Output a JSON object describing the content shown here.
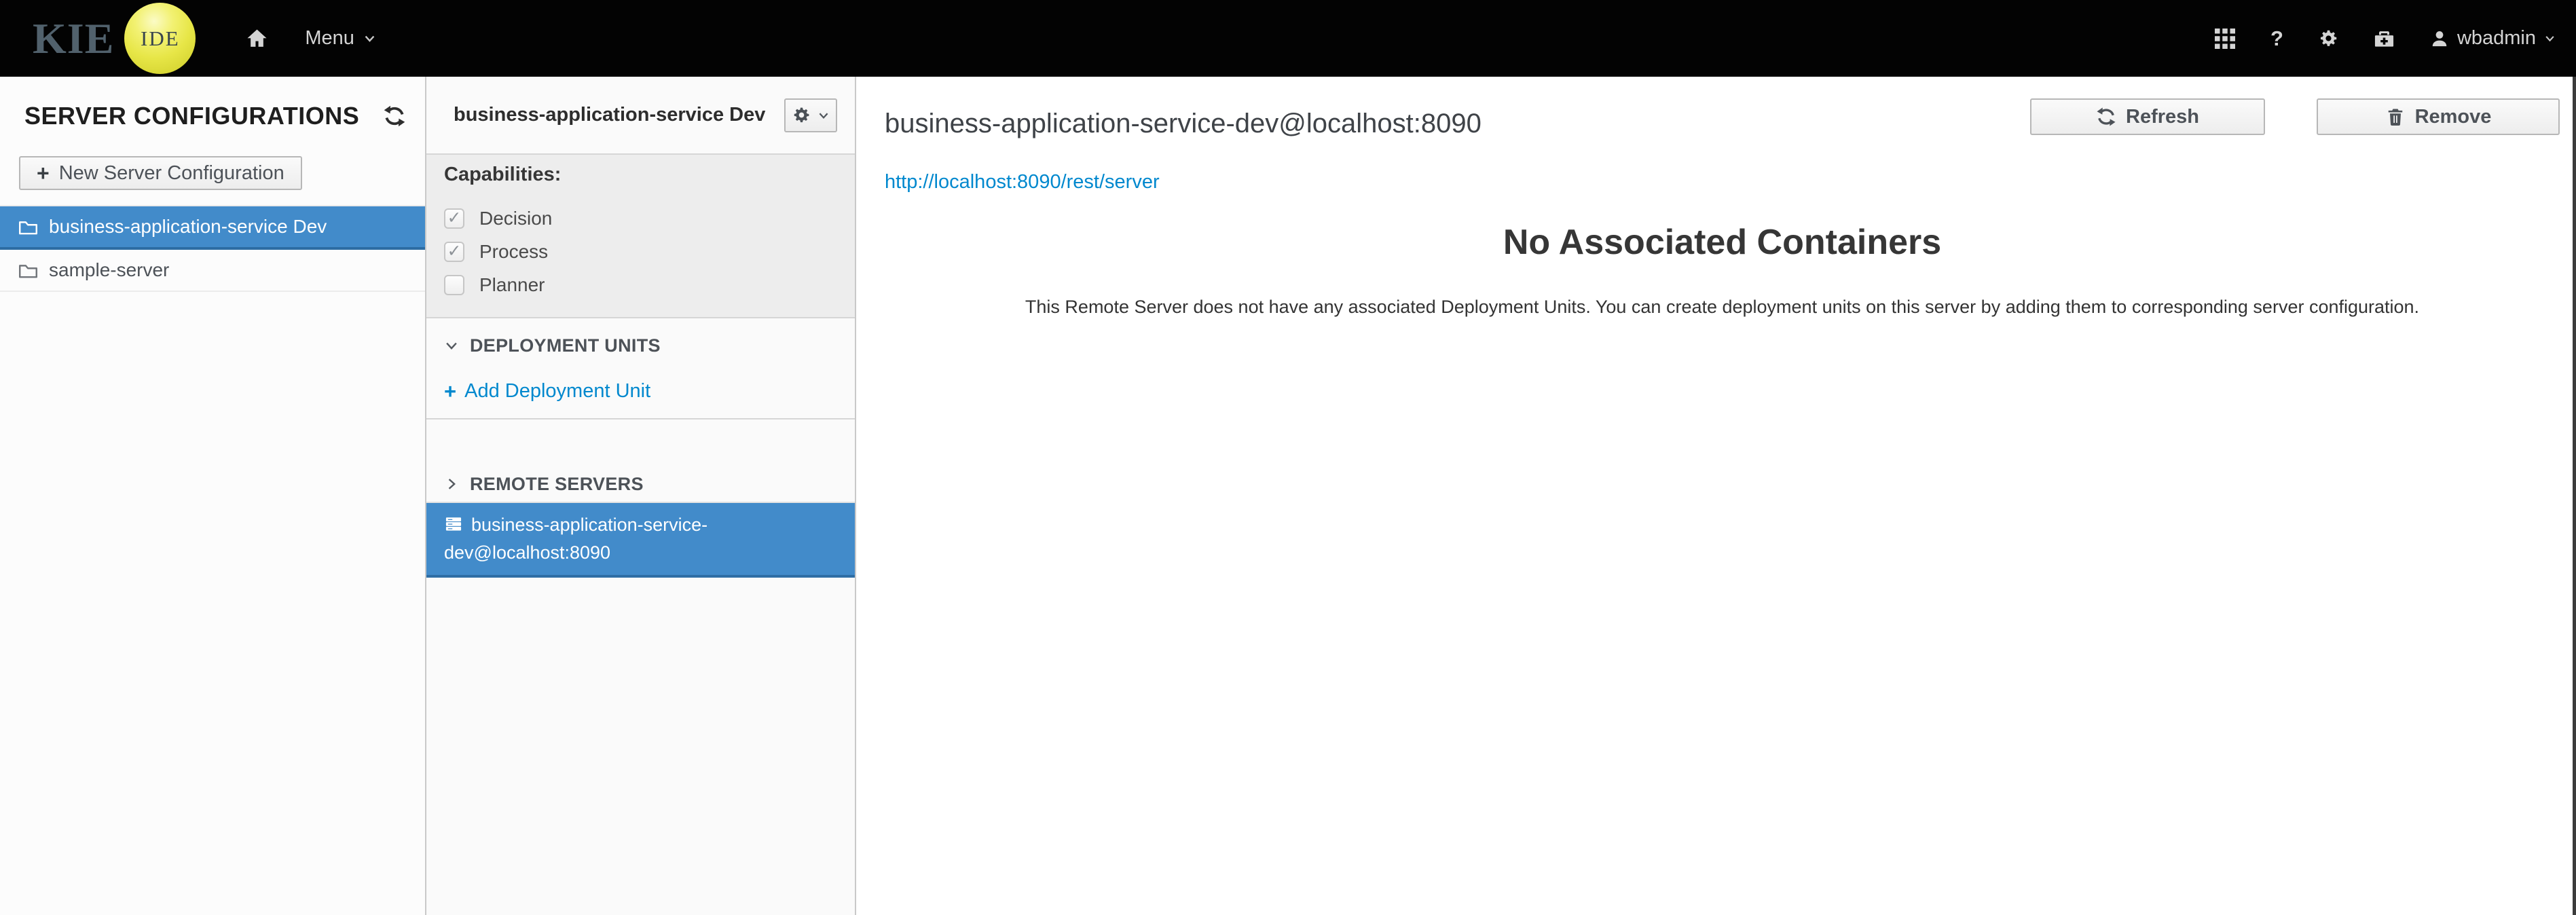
{
  "navbar": {
    "logo_text": "KIE",
    "logo_badge": "IDE",
    "menu_label": "Menu",
    "username": "wbadmin"
  },
  "icons": {
    "help": "?",
    "plus": "+",
    "check": "✓"
  },
  "sidebar": {
    "title": "SERVER CONFIGURATIONS",
    "new_button_label": "New Server Configuration",
    "items": [
      {
        "label": "business-application-service Dev",
        "selected": true
      },
      {
        "label": "sample-server",
        "selected": false
      }
    ]
  },
  "panel": {
    "title": "business-application-service Dev",
    "capabilities_label": "Capabilities:",
    "capabilities": [
      {
        "label": "Decision",
        "checked": true
      },
      {
        "label": "Process",
        "checked": true
      },
      {
        "label": "Planner",
        "checked": false
      }
    ],
    "deployment_units": {
      "title": "DEPLOYMENT UNITS",
      "add_label": "Add Deployment Unit"
    },
    "remote_servers": {
      "title": "REMOTE SERVERS",
      "items": [
        {
          "label": "business-application-service-dev@localhost:8090",
          "selected": true
        }
      ]
    }
  },
  "main": {
    "title": "business-application-service-dev@localhost:8090",
    "url": "http://localhost:8090/rest/server",
    "refresh_label": "Refresh",
    "remove_label": "Remove",
    "empty_title": "No Associated Containers",
    "empty_message": "This Remote Server does not have any associated Deployment Units. You can create deployment units on this server by adding them to corresponding server configuration."
  },
  "colors": {
    "navbar_bg": "#030303",
    "selection_blue": "#428bca",
    "link_blue": "#0088ce",
    "logo_yellow": "#e7e647"
  }
}
